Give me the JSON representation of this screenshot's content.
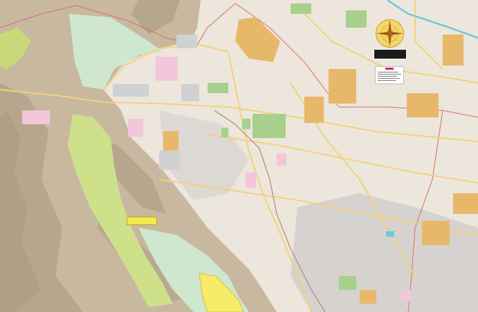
{
  "map": {
    "title": "",
    "compass_icon": "compass-rose-icon",
    "colors": {
      "terrain": "#c9b8a0",
      "terrain_dark": "#a9977f",
      "urban": "#ece6dc",
      "urban_dense": "#d6d2cf",
      "park_light": "#cfe6cf",
      "park_green": "#a8d08d",
      "yellow_green": "#cfe08a",
      "orange_zone": "#e8b86a",
      "pink_zone": "#f3c6d9",
      "yellow_zone": "#f7ec6a",
      "boundary": "#d86a6a",
      "main_road": "#f2d27a",
      "river": "#6cc7e0",
      "railway": "#b58a70"
    }
  }
}
